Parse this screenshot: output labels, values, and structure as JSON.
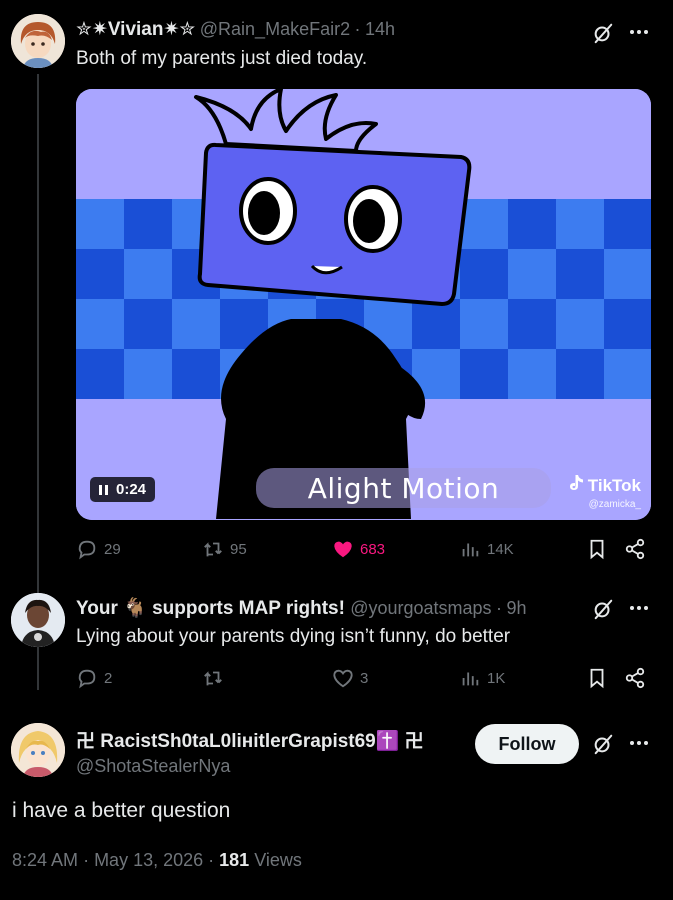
{
  "tweet1": {
    "display_name": "✮✷Vivian✷✮",
    "handle": "@Rain_MakeFair2",
    "time": "14h",
    "text": "Both of my parents just died today.",
    "video": {
      "duration": "0:24",
      "watermark": "Alight Motion",
      "platform": "TikTok",
      "platform_user": "@zamicka_"
    },
    "actions": {
      "replies": "29",
      "reposts": "95",
      "likes": "683",
      "views": "14K"
    }
  },
  "tweet2": {
    "display_name_prefix": "Your",
    "display_name_emoji": "🐐",
    "display_name_suffix": "supports MAP rights!",
    "handle": "@yourgoatsmaps",
    "time": "9h",
    "text": "Lying about your parents dying isn’t funny, do better",
    "actions": {
      "replies": "2",
      "reposts": "",
      "likes": "3",
      "views": "1K"
    }
  },
  "tweet3": {
    "display_name": "卍 RacistSh0taL0lінitlerGrapist69✝️ 卍",
    "handle": "@ShotaStealerNya",
    "follow_label": "Follow",
    "text": "i have a better question",
    "time": "8:24 AM",
    "date": "May 13, 2026",
    "views_count": "181",
    "views_label": "Views"
  },
  "colors": {
    "background": "#000000",
    "text": "#e7e9ea",
    "muted": "#71767b",
    "like_active": "#f91880",
    "follow_bg": "#eff3f4"
  }
}
